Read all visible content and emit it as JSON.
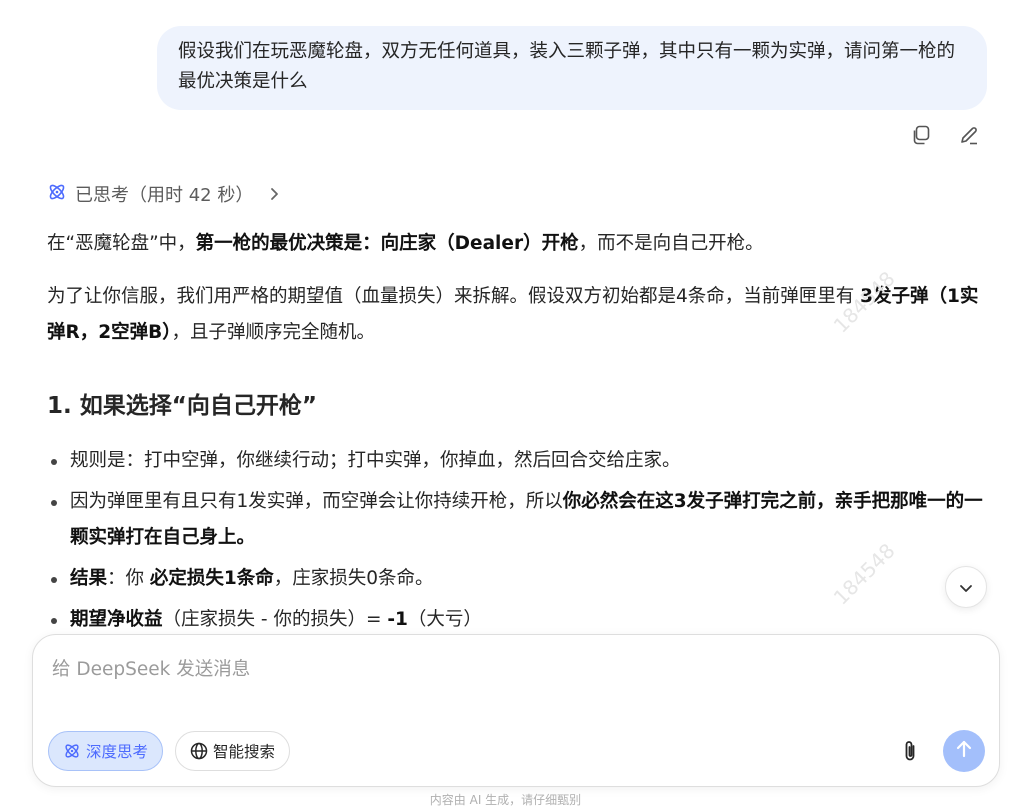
{
  "user_message": {
    "text": "假设我们在玩恶魔轮盘，双方无任何道具，装入三颗子弹，其中只有一颗为实弹，请问第一枪的最优决策是什么"
  },
  "message_actions": {
    "copy_icon": "copy-icon",
    "edit_icon": "edit-icon"
  },
  "thinking": {
    "label": "已思考（用时 42 秒）"
  },
  "answer": {
    "p1": {
      "t1": "在“恶魔轮盘”中，",
      "b1": "第一枪的最优决策是：向庄家（Dealer）开枪",
      "t2": "，而不是向自己开枪。"
    },
    "p2": {
      "t1": "为了让你信服，我们用严格的期望值（血量损失）来拆解。假设双方初始都是4条命，当前弹匣里有 ",
      "b1": "3发子弹（1实弹R，2空弹B）",
      "t2": "，且子弹顺序完全随机。"
    },
    "heading1": "1. 如果选择“向自己开枪”",
    "bullets": [
      {
        "t1": "规则是：打中空弹，你继续行动；打中实弹，你掉血，然后回合交给庄家。"
      },
      {
        "t1": "因为弹匣里有且只有1发实弹，而空弹会让你持续开枪，所以",
        "b1": "你必然会在这3发子弹打完之前，亲手把那唯一的一颗实弹打在自己身上。"
      },
      {
        "b1": "结果",
        "t1": "：你 ",
        "b2": "必定损失1条命",
        "t2": "，庄家损失0条命。"
      },
      {
        "b1": "期望净收益",
        "t1": "（庄家损失 - 你的损失）= ",
        "b2": "-1",
        "t2": "（大亏）"
      }
    ]
  },
  "watermark": "184548",
  "composer": {
    "placeholder": "给 DeepSeek 发送消息",
    "deep_think_label": "深度思考",
    "search_label": "智能搜索"
  },
  "footer_note": "内容由 AI 生成，请仔细甄别"
}
